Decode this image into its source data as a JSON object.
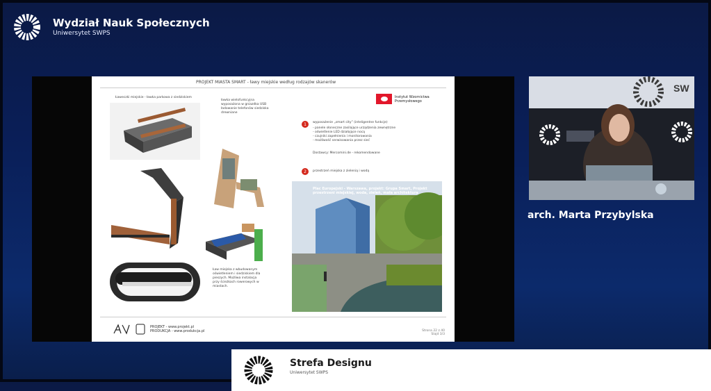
{
  "brand": {
    "title": "Wydział Nauk Społecznych",
    "subtitle": "Uniwersytet SWPS"
  },
  "slide": {
    "header": "PROJEKT MIASTA SMART - ławy miejskie według rodzajów skanerów",
    "logo_name": "Instytut Wzornictwa Przemysłowego",
    "num1": "1",
    "num2": "2",
    "section1_note": "Ławeczki miejskie - ławka parkowa z siedziskiem",
    "section1_text": "ławka wielofunkcyjna wyposażona w gniazdka USB ładowanie telefonów siedziska drewniane",
    "bullet1": "wyposażenie „smart city” (inteligentne funkcje)",
    "bullet1_detail": "- panele słoneczne zasilające urządzenia zewnętrzne\n- oświetlenie LED działające nocą\n- czujniki zapełnienia i monitorowania\n- możliwość serwisowania przez sieć",
    "source_line": "Dostawcy: Mercomini.de - rekomendowane",
    "bullet2": "przestrzeń miejska z zielenią i wodą",
    "caption2": "Ław miejska z wbudowanym oświetleniem i siedziskiem dla pieszych. Możliwa instalacja przy ścieżkach rowerowych w miastach.",
    "photo_caption": "Plac Europejski - Warszawa, projekt: Grupa Smart, Projekt przestrzeni miejskiej, woda, zieleń, mała architektura",
    "footer_brand": "PROJEKT - www.projekt.pl\nPRODUKCJA - www.produkcja.pl",
    "footer_right": "Strona 22 z 40\nSlajd 3/3"
  },
  "speaker": {
    "name": "arch. Marta Przybylska",
    "camera_brand": "SW"
  },
  "banner": {
    "name": "Strefa Designu",
    "subtitle": "Uniwersytet SWPS"
  }
}
